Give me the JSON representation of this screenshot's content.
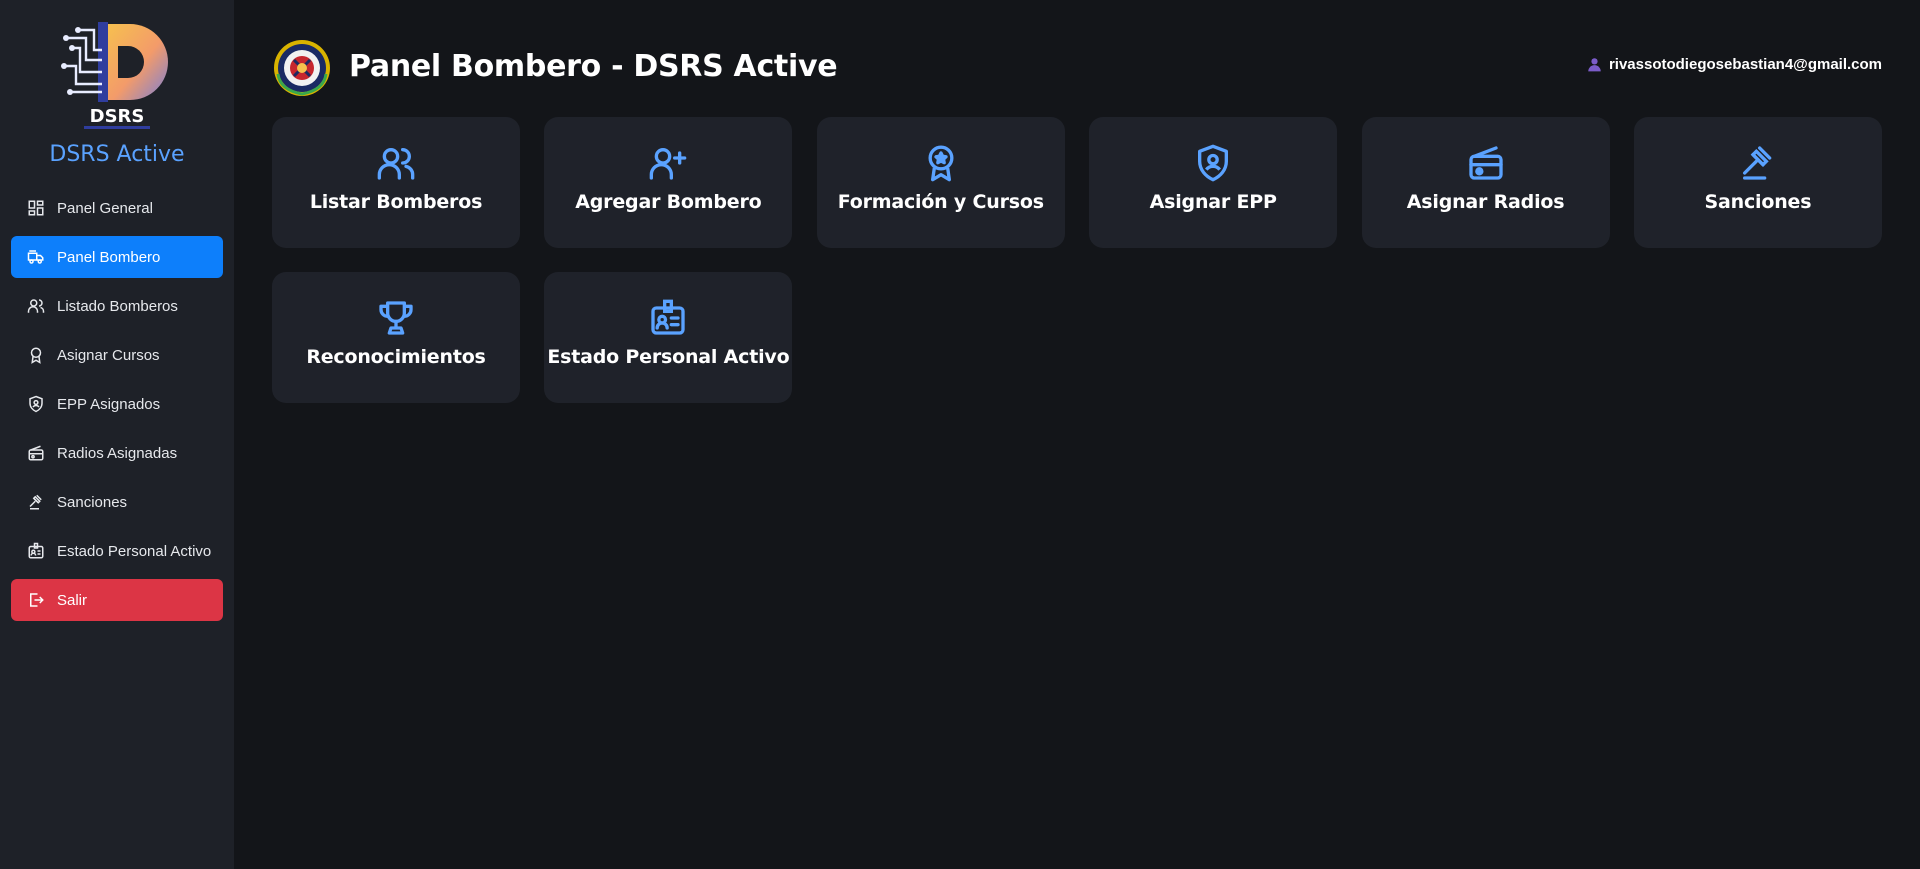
{
  "colors": {
    "accent": "#5aa2ff",
    "active": "#0d7ffb",
    "danger": "#dc3545",
    "sidebar_bg": "#1e2128",
    "main_bg": "#131519",
    "card_bg": "#1f222a"
  },
  "brand": {
    "logo_text": "DSRS",
    "title": "DSRS Active"
  },
  "sidebar": {
    "items": [
      {
        "label": "Panel General",
        "icon": "dashboard-icon"
      },
      {
        "label": "Panel Bombero",
        "icon": "fire-truck-icon",
        "active": true
      },
      {
        "label": "Listado Bomberos",
        "icon": "people-icon"
      },
      {
        "label": "Asignar Cursos",
        "icon": "award-icon"
      },
      {
        "label": "EPP Asignados",
        "icon": "shield-icon"
      },
      {
        "label": "Radios Asignadas",
        "icon": "radio-icon"
      },
      {
        "label": "Sanciones",
        "icon": "gavel-icon"
      },
      {
        "label": "Estado Personal Activo",
        "icon": "id-badge-icon"
      },
      {
        "label": "Salir",
        "icon": "logout-icon",
        "danger": true
      }
    ]
  },
  "header": {
    "title": "Panel Bombero - DSRS Active",
    "user_email": "rivassotodiegosebastian4@gmail.com",
    "user_icon": "user-icon"
  },
  "cards": [
    {
      "label": "Listar Bomberos",
      "icon": "people-icon"
    },
    {
      "label": "Agregar Bombero",
      "icon": "person-add-icon"
    },
    {
      "label": "Formación y Cursos",
      "icon": "award-icon"
    },
    {
      "label": "Asignar EPP",
      "icon": "shield-icon"
    },
    {
      "label": "Asignar Radios",
      "icon": "radio-icon"
    },
    {
      "label": "Sanciones",
      "icon": "gavel-icon"
    },
    {
      "label": "Reconocimientos",
      "icon": "trophy-icon"
    },
    {
      "label": "Estado Personal Activo",
      "icon": "id-badge-icon"
    }
  ]
}
